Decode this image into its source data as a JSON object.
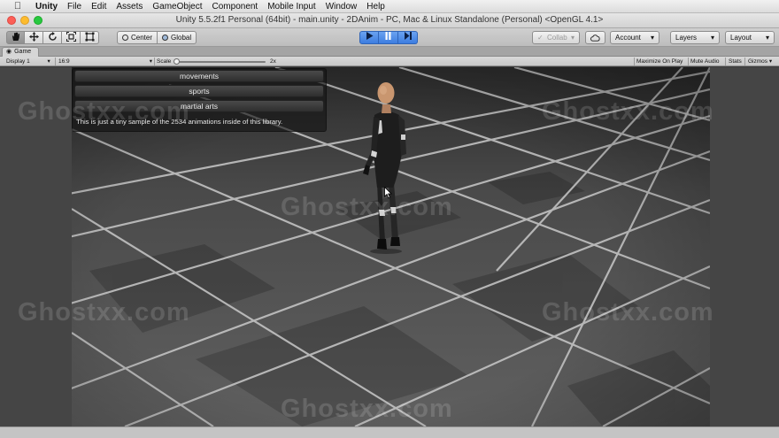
{
  "menubar": {
    "apple_icon": "apple-logo-icon",
    "items": [
      "Unity",
      "File",
      "Edit",
      "Assets",
      "GameObject",
      "Component",
      "Mobile Input",
      "Window",
      "Help"
    ]
  },
  "window": {
    "title": "Unity 5.5.2f1 Personal (64bit) - main.unity - 2DAnim - PC, Mac & Linux Standalone (Personal) <OpenGL 4.1>"
  },
  "toolbar": {
    "tool_icons": [
      "hand-icon",
      "move-icon",
      "rotate-icon",
      "scale-icon",
      "rect-tool-icon"
    ],
    "pivot_label": "Center",
    "rotation_label": "Global",
    "play_icons": [
      "play-icon",
      "pause-icon",
      "step-icon"
    ],
    "collab_label": "Collab",
    "account_label": "Account",
    "layers_label": "Layers",
    "layout_label": "Layout",
    "dropdown_glyph": "▾"
  },
  "game_tab": {
    "label": "Game"
  },
  "game_bar": {
    "display_label": "Display 1",
    "aspect_label": "16:9",
    "scale_label": "Scale",
    "scale_value": "2x",
    "scale_level": 0.0,
    "maximize_label": "Maximize On Play",
    "mute_label": "Mute Audio",
    "stats_label": "Stats",
    "gizmos_label": "Gizmos"
  },
  "gui": {
    "buttons": [
      "movements",
      "sports",
      "martial arts"
    ],
    "info_text": "This is just a tiny sample of the 2534 animations inside of this library."
  },
  "watermark": {
    "text": "Ghostxx.com"
  },
  "colors": {
    "play_active": "#3d7de0",
    "viewport_floor": "#5a5a5a",
    "grout": "#c8c8c8"
  }
}
